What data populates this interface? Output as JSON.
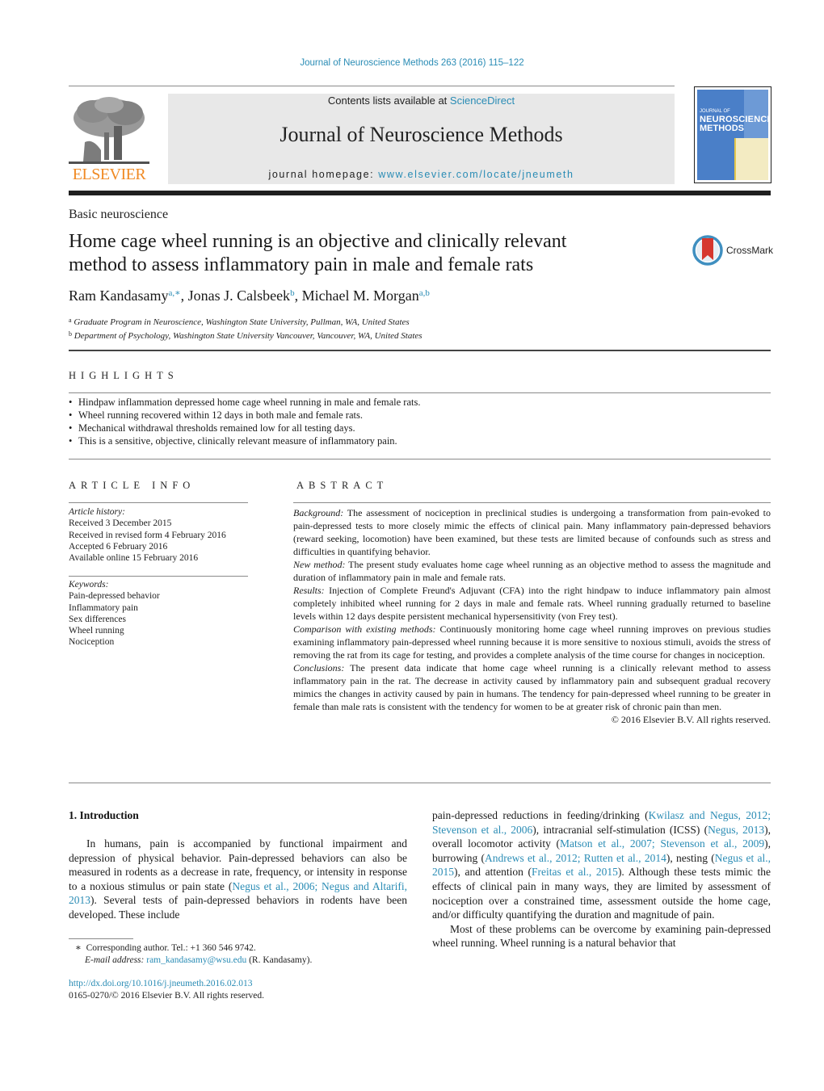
{
  "running_head": "Journal of Neuroscience Methods 263 (2016) 115–122",
  "header": {
    "publisher_logo_text": "ELSEVIER",
    "contents_prefix": "Contents lists available at ",
    "contents_link": "ScienceDirect",
    "journal_title": "Journal of Neuroscience Methods",
    "homepage_prefix": "journal homepage: ",
    "homepage_link": "www.elsevier.com/locate/jneumeth",
    "cover": {
      "line1": "JOURNAL OF",
      "line2": "NEUROSCIENCE",
      "line3": "METHODS"
    },
    "colors": {
      "link": "#2a8cb5",
      "elsevier_orange": "#f08a24",
      "banner_gray": "#e8e8e8",
      "cover_blue": "#4a7fc8"
    }
  },
  "article": {
    "section": "Basic neuroscience",
    "title_line1": "Home cage wheel running is an objective and clinically relevant",
    "title_line2": "method to assess inflammatory pain in male and female rats",
    "crossmark_label": "CrossMark",
    "authors": [
      {
        "name": "Ram Kandasamy",
        "sup": "a,∗",
        "sep": ", "
      },
      {
        "name": "Jonas J. Calsbeek",
        "sup": "b",
        "sep": ", "
      },
      {
        "name": "Michael M. Morgan",
        "sup": "a,b",
        "sep": ""
      }
    ],
    "affiliations": [
      {
        "key": "a",
        "text": "Graduate Program in Neuroscience, Washington State University, Pullman, WA, United States"
      },
      {
        "key": "b",
        "text": "Department of Psychology, Washington State University Vancouver, Vancouver, WA, United States"
      }
    ]
  },
  "highlights": {
    "heading": "HIGHLIGHTS",
    "items": [
      "Hindpaw inflammation depressed home cage wheel running in male and female rats.",
      "Wheel running recovered within 12 days in both male and female rats.",
      "Mechanical withdrawal thresholds remained low for all testing days.",
      "This is a sensitive, objective, clinically relevant measure of inflammatory pain."
    ]
  },
  "article_info": {
    "heading": "ARTICLE INFO",
    "history_label": "Article history:",
    "history": [
      "Received 3 December 2015",
      "Received in revised form 4 February 2016",
      "Accepted 6 February 2016",
      "Available online 15 February 2016"
    ],
    "keywords_label": "Keywords:",
    "keywords": [
      "Pain-depressed behavior",
      "Inflammatory pain",
      "Sex differences",
      "Wheel running",
      "Nociception"
    ]
  },
  "abstract": {
    "heading": "ABSTRACT",
    "sections": [
      {
        "label": "Background:",
        "text": " The assessment of nociception in preclinical studies is undergoing a transformation from pain-evoked to pain-depressed tests to more closely mimic the effects of clinical pain. Many inflammatory pain-depressed behaviors (reward seeking, locomotion) have been examined, but these tests are limited because of confounds such as stress and difficulties in quantifying behavior."
      },
      {
        "label": "New method:",
        "text": " The present study evaluates home cage wheel running as an objective method to assess the magnitude and duration of inflammatory pain in male and female rats."
      },
      {
        "label": "Results:",
        "text": " Injection of Complete Freund's Adjuvant (CFA) into the right hindpaw to induce inflammatory pain almost completely inhibited wheel running for 2 days in male and female rats. Wheel running gradually returned to baseline levels within 12 days despite persistent mechanical hypersensitivity (von Frey test)."
      },
      {
        "label": "Comparison with existing methods:",
        "text": " Continuously monitoring home cage wheel running improves on previous studies examining inflammatory pain-depressed wheel running because it is more sensitive to noxious stimuli, avoids the stress of removing the rat from its cage for testing, and provides a complete analysis of the time course for changes in nociception."
      },
      {
        "label": "Conclusions:",
        "text": " The present data indicate that home cage wheel running is a clinically relevant method to assess inflammatory pain in the rat. The decrease in activity caused by inflammatory pain and subsequent gradual recovery mimics the changes in activity caused by pain in humans. The tendency for pain-depressed wheel running to be greater in female than male rats is consistent with the tendency for women to be at greater risk of chronic pain than men."
      }
    ],
    "copyright": "© 2016 Elsevier B.V. All rights reserved."
  },
  "introduction": {
    "heading": "1.  Introduction",
    "col1_p1": [
      {
        "t": "In humans, pain is accompanied by functional impairment and depression of physical behavior. Pain-depressed behaviors can also be measured in rodents as a decrease in rate, frequency, or intensity in response to a noxious stimulus or pain state ("
      },
      {
        "link": "Negus et al., 2006; Negus and Altarifi, 2013"
      },
      {
        "t": "). Several tests of pain-depressed behaviors in rodents have been developed. These include"
      }
    ],
    "col2_p1": [
      {
        "t": "pain-depressed reductions in feeding/drinking ("
      },
      {
        "link": "Kwilasz and Negus, 2012; Stevenson et al., 2006"
      },
      {
        "t": "), intracranial self-stimulation (ICSS) ("
      },
      {
        "link": "Negus, 2013"
      },
      {
        "t": "), overall locomotor activity ("
      },
      {
        "link": "Matson et al., 2007; Stevenson et al., 2009"
      },
      {
        "t": "), burrowing ("
      },
      {
        "link": "Andrews et al., 2012; Rutten et al., 2014"
      },
      {
        "t": "), nesting ("
      },
      {
        "link": "Negus et al., 2015"
      },
      {
        "t": "), and attention ("
      },
      {
        "link": "Freitas et al., 2015"
      },
      {
        "t": "). Although these tests mimic the effects of clinical pain in many ways, they are limited by assessment of nociception over a constrained time, assessment outside the home cage, and/or difficulty quantifying the duration and magnitude of pain."
      }
    ],
    "col2_p2": "Most of these problems can be overcome by examining pain-depressed wheel running. Wheel running is a natural behavior that"
  },
  "footnotes": {
    "star": "∗",
    "corresponding": "Corresponding author. Tel.: +1 360 546 9742.",
    "email_label": "E-mail address:",
    "email": "ram_kandasamy@wsu.edu",
    "email_suffix": " (R. Kandasamy).",
    "doi": "http://dx.doi.org/10.1016/j.jneumeth.2016.02.013",
    "issn_line": "0165-0270/© 2016 Elsevier B.V. All rights reserved."
  }
}
